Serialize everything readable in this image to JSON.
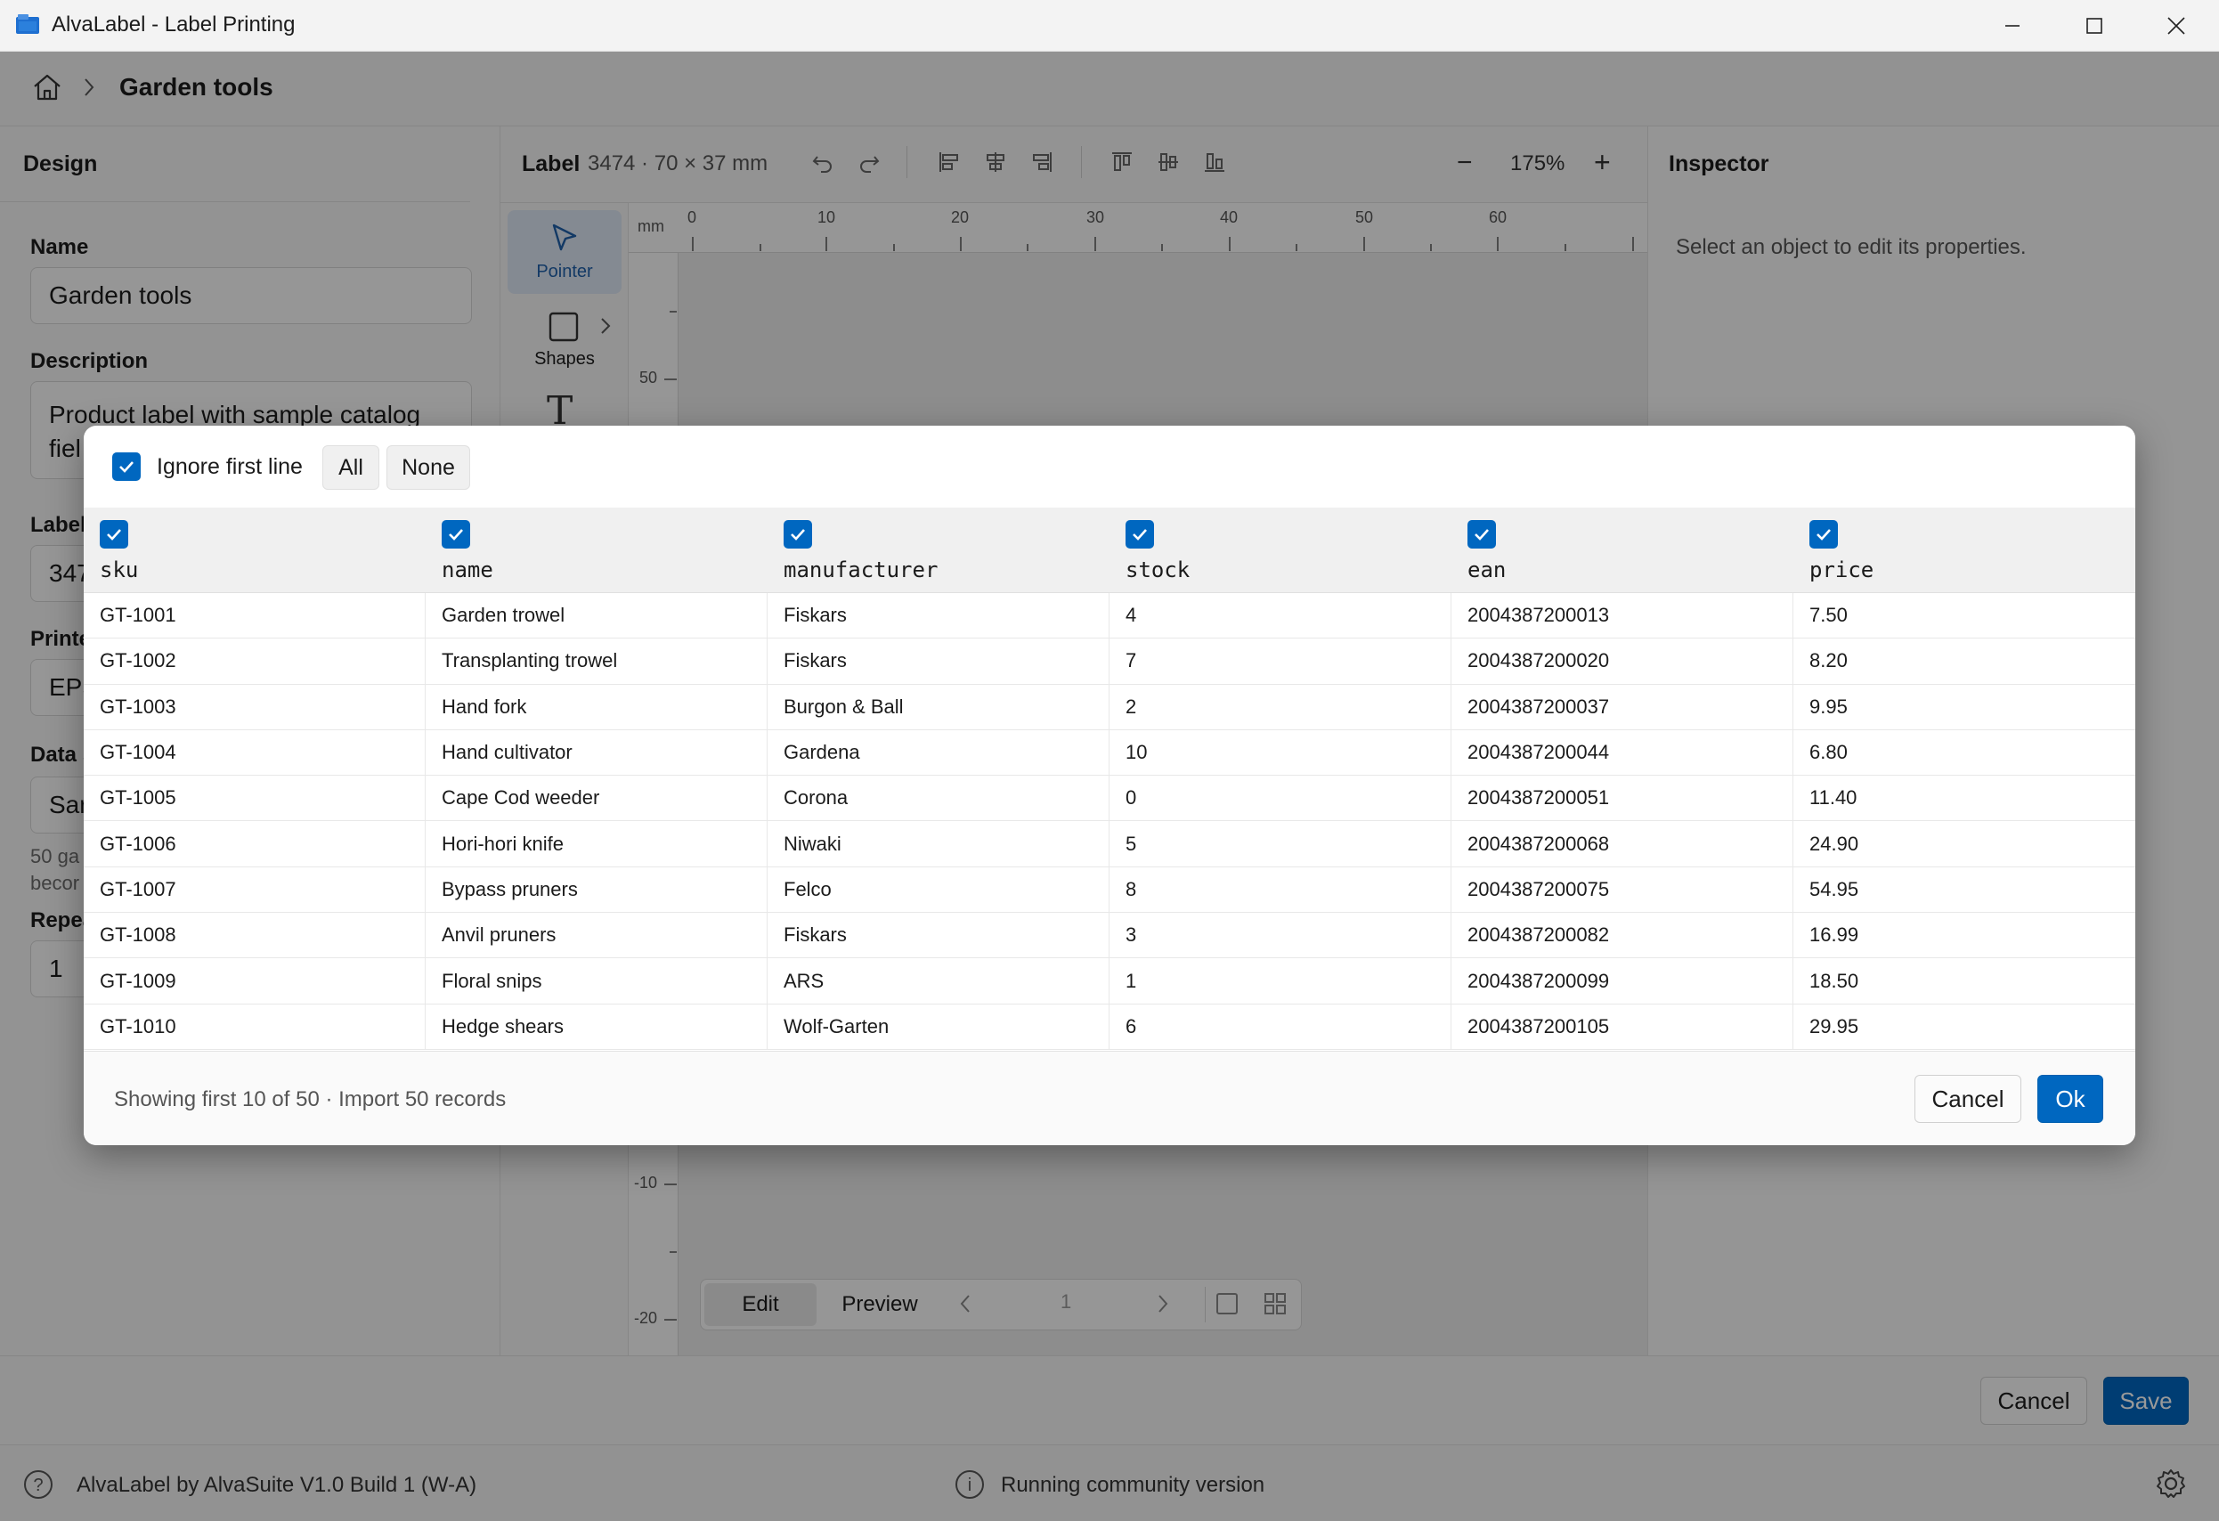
{
  "window": {
    "title": "AlvaLabel - Label Printing",
    "minimize_icon": "minimize-icon",
    "maximize_icon": "maximize-icon",
    "close_icon": "close-icon"
  },
  "breadcrumb": {
    "home_icon": "home-icon",
    "current": "Garden tools"
  },
  "design_panel": {
    "title": "Design",
    "name_label": "Name",
    "name_value": "Garden tools",
    "description_label": "Description",
    "description_value": "Product label with sample catalog fiel",
    "label_label": "Label",
    "label_value": "347",
    "printer_label": "Printe",
    "printer_value": "EPS",
    "data_label": "Data s",
    "data_value": "Sar",
    "data_hint_line1": "50 ga",
    "data_hint_line2": "becor",
    "repeat_label": "Repea",
    "repeat_value": "1"
  },
  "canvas_toolbar": {
    "label_word": "Label",
    "label_dims": "3474 · 70 × 37 mm",
    "zoom": "175%",
    "zoom_out_label": "−",
    "zoom_in_label": "+"
  },
  "tools": {
    "pointer_label": "Pointer",
    "shapes_label": "Shapes",
    "text_glyph": "T"
  },
  "rulers": {
    "unit": "mm",
    "top_ticks": [
      "0",
      "10",
      "20",
      "30",
      "40",
      "50",
      "60"
    ],
    "left_ticks": [
      "50",
      "-10",
      "-20"
    ]
  },
  "inspector": {
    "title": "Inspector",
    "hint": "Select an object to edit its properties."
  },
  "mode_bar": {
    "edit": "Edit",
    "preview": "Preview",
    "page": "1"
  },
  "bottom_actions": {
    "cancel": "Cancel",
    "save": "Save"
  },
  "status": {
    "version": "AlvaLabel by AlvaSuite V1.0 Build 1 (W-A)",
    "license": "Running community version"
  },
  "dialog": {
    "ignore_first_line": "Ignore first line",
    "all": "All",
    "none": "None",
    "columns": [
      "sku",
      "name",
      "manufacturer",
      "stock",
      "ean",
      "price"
    ],
    "rows": [
      [
        "GT-1001",
        "Garden trowel",
        "Fiskars",
        "4",
        "2004387200013",
        "7.50"
      ],
      [
        "GT-1002",
        "Transplanting trowel",
        "Fiskars",
        "7",
        "2004387200020",
        "8.20"
      ],
      [
        "GT-1003",
        "Hand fork",
        "Burgon & Ball",
        "2",
        "2004387200037",
        "9.95"
      ],
      [
        "GT-1004",
        "Hand cultivator",
        "Gardena",
        "10",
        "2004387200044",
        "6.80"
      ],
      [
        "GT-1005",
        "Cape Cod weeder",
        "Corona",
        "0",
        "2004387200051",
        "11.40"
      ],
      [
        "GT-1006",
        "Hori-hori knife",
        "Niwaki",
        "5",
        "2004387200068",
        "24.90"
      ],
      [
        "GT-1007",
        "Bypass pruners",
        "Felco",
        "8",
        "2004387200075",
        "54.95"
      ],
      [
        "GT-1008",
        "Anvil pruners",
        "Fiskars",
        "3",
        "2004387200082",
        "16.99"
      ],
      [
        "GT-1009",
        "Floral snips",
        "ARS",
        "1",
        "2004387200099",
        "18.50"
      ],
      [
        "GT-1010",
        "Hedge shears",
        "Wolf-Garten",
        "6",
        "2004387200105",
        "29.95"
      ]
    ],
    "footer_text": "Showing first 10 of 50 · Import 50 records",
    "cancel": "Cancel",
    "ok": "Ok"
  },
  "colors": {
    "accent": "#0067c0",
    "overlay": "rgba(0,0,0,0.40)"
  }
}
